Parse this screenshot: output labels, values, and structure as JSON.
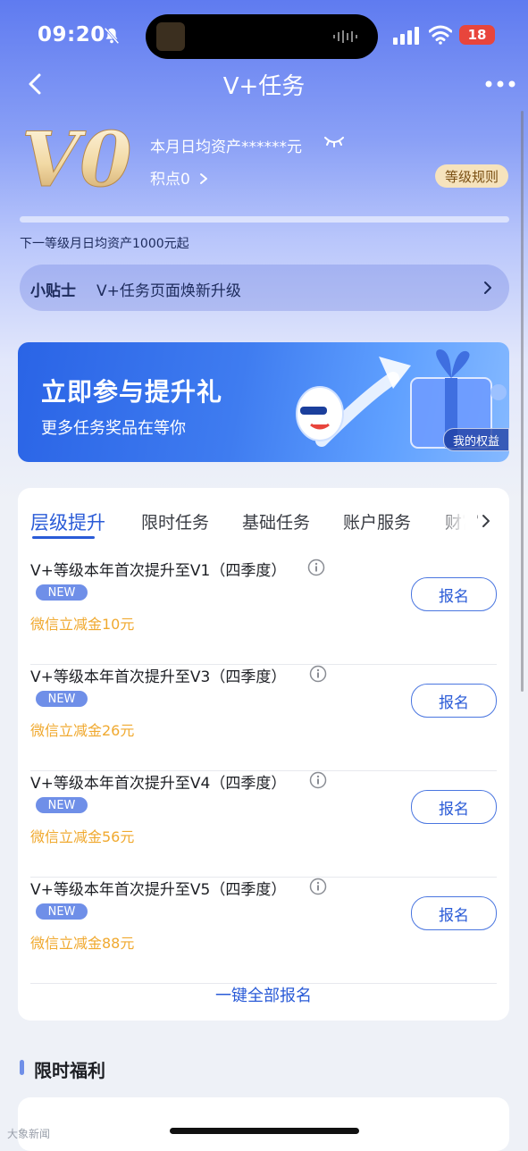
{
  "status_bar": {
    "time": "09:20",
    "battery": "18"
  },
  "nav": {
    "title": "V+任务"
  },
  "level": {
    "badge": "V0",
    "asset_label": "本月日均资产******元",
    "points_label": "积点0",
    "rules_button": "等级规则",
    "progress_fraction": 0.0,
    "next_level_text": "下一等级月日均资产1000元起"
  },
  "tips": {
    "label": "小贴士",
    "text": "V+任务页面焕新升级"
  },
  "banner": {
    "title": "立即参与提升礼",
    "subtitle": "更多任务奖品在等你",
    "rights_tag": "我的权益"
  },
  "tabs": [
    {
      "label": "层级提升",
      "active": true
    },
    {
      "label": "限时任务",
      "active": false
    },
    {
      "label": "基础任务",
      "active": false
    },
    {
      "label": "账户服务",
      "active": false
    },
    {
      "label": "财富",
      "active": false
    }
  ],
  "tasks": [
    {
      "title": "V+等级本年首次提升至V1（四季度）",
      "badge": "NEW",
      "reward": "微信立减金10元",
      "button": "报名"
    },
    {
      "title": "V+等级本年首次提升至V3（四季度）",
      "badge": "NEW",
      "reward": "微信立减金26元",
      "button": "报名"
    },
    {
      "title": "V+等级本年首次提升至V4（四季度）",
      "badge": "NEW",
      "reward": "微信立减金56元",
      "button": "报名"
    },
    {
      "title": "V+等级本年首次提升至V5（四季度）",
      "badge": "NEW",
      "reward": "微信立减金88元",
      "button": "报名"
    }
  ],
  "all_signup": "一键全部报名",
  "section": {
    "title": "限时福利"
  },
  "watermark": "大象新闻",
  "icons": {
    "back": "chevron-left-icon",
    "more": "more-dots-icon",
    "eye": "eye-closed-icon",
    "info": "info-icon",
    "arrow": "chevron-right-icon",
    "bell": "bell-muted-icon"
  },
  "colors": {
    "accent": "#2a5bd7",
    "reward": "#f0a92f",
    "new_badge": "#6f8fe8",
    "rules_bg": "#f6e3bd"
  }
}
